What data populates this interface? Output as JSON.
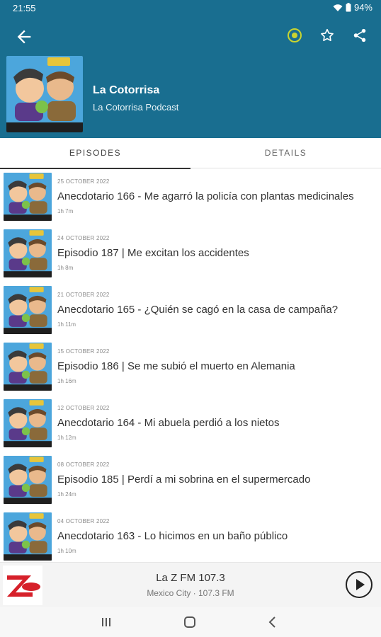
{
  "status": {
    "time": "21:55",
    "battery": "94%",
    "icons": [
      "wifi-icon",
      "battery-icon"
    ]
  },
  "appbar": {
    "podcast_title": "La Cotorrisa",
    "podcast_author": "La Cotorrisa Podcast",
    "actions": [
      "back-icon",
      "radio-icon",
      "star-icon",
      "share-icon"
    ],
    "color": "#196e90"
  },
  "tabs": [
    {
      "label": "EPISODES",
      "active": true
    },
    {
      "label": "DETAILS",
      "active": false
    }
  ],
  "episodes": [
    {
      "date": "25 OCTOBER 2022",
      "title": "Anecdotario 166 - Me agarró la policía con plantas medicinales",
      "duration": "1h 7m"
    },
    {
      "date": "24 OCTOBER 2022",
      "title": "Episodio 187 | Me excitan los accidentes",
      "duration": "1h 8m"
    },
    {
      "date": "21 OCTOBER 2022",
      "title": "Anecdotario 165 - ¿Quién se cagó en la casa de campaña?",
      "duration": "1h 11m"
    },
    {
      "date": "15 OCTOBER 2022",
      "title": "Episodio 186 | Se me subió el muerto en Alemania",
      "duration": "1h 16m"
    },
    {
      "date": "12 OCTOBER 2022",
      "title": "Anecdotario 164 - Mi abuela perdió a los nietos",
      "duration": "1h 12m"
    },
    {
      "date": "08 OCTOBER 2022",
      "title": "Episodio 185 | Perdí a mi sobrina en el supermercado",
      "duration": "1h 24m"
    },
    {
      "date": "04 OCTOBER 2022",
      "title": "Anecdotario 163 - Lo hicimos en un baño público",
      "duration": "1h 10m"
    }
  ],
  "player": {
    "station": "La Z FM 107.3",
    "subtitle": "Mexico City · 107.3 FM",
    "logo_text": "La Z 107.3 fm"
  },
  "navbar": [
    "recents-icon",
    "home-icon",
    "back-nav-icon"
  ]
}
